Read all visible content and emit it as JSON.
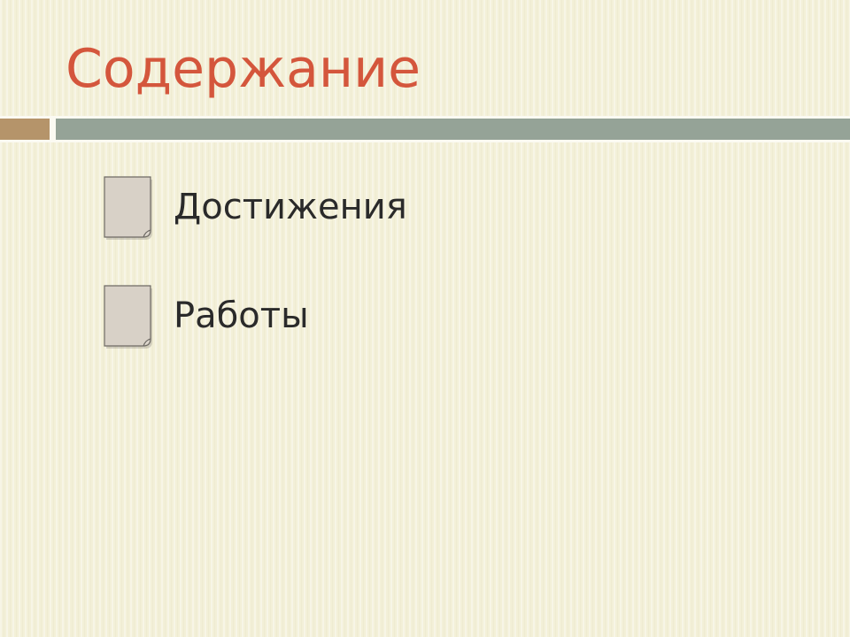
{
  "slide": {
    "title": "Содержание",
    "items": [
      {
        "label": "Достижения",
        "icon": "document-icon"
      },
      {
        "label": "Работы",
        "icon": "document-icon"
      }
    ]
  },
  "colors": {
    "title": "#d4563c",
    "background": "#f3f0d8",
    "divider_accent": "#b5946a",
    "divider_bar": "#95a397",
    "bullet_fill": "#d8d1c7",
    "text": "#2a2a2a"
  }
}
